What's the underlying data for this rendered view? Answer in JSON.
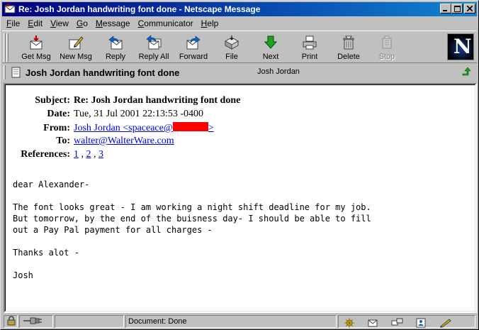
{
  "window": {
    "title": "Re: Josh Jordan handwriting font done - Netscape Message",
    "minimize": "_",
    "maximize": "□",
    "close": "✕"
  },
  "menu": [
    {
      "label": "File",
      "key": "F",
      "rest": "ile"
    },
    {
      "label": "Edit",
      "key": "E",
      "rest": "dit"
    },
    {
      "label": "View",
      "key": "V",
      "rest": "iew"
    },
    {
      "label": "Go",
      "key": "G",
      "rest": "o"
    },
    {
      "label": "Message",
      "key": "M",
      "rest": "essage"
    },
    {
      "label": "Communicator",
      "key": "C",
      "rest": "ommunicator"
    },
    {
      "label": "Help",
      "key": "H",
      "rest": "elp"
    }
  ],
  "toolbar": {
    "get_msg": "Get Msg",
    "new_msg": "New Msg",
    "reply": "Reply",
    "reply_all": "Reply All",
    "forward": "Forward",
    "file": "File",
    "next": "Next",
    "print": "Print",
    "delete": "Delete",
    "stop": "Stop",
    "logo_letter": "N"
  },
  "summary": {
    "title": "Josh Jordan handwriting font done",
    "from": "Josh Jordan"
  },
  "headers": {
    "subject_label": "Subject:",
    "subject": "Re: Josh Jordan handwriting font done",
    "date_label": "Date:",
    "date": "Tue, 31 Jul 2001 22:13:53 -0400",
    "from_label": "From:",
    "from_prefix": "Josh Jordan <spaceace@",
    "from_suffix": ">",
    "to_label": "To:",
    "to": "walter@WalterWare.com",
    "references_label": "References:",
    "ref1": "1",
    "ref2": "2",
    "ref3": "3",
    "ref_sep": " , "
  },
  "body": "dear Alexander-\n\nThe font looks great - I am working a night shift deadline for my job.\nBut tomorrow, by the end of the buisness day- I should be able to fill\nout a Pay Pal payment for all charges -\n\nThanks alot -\n\nJosh",
  "status": {
    "text": "Document: Done"
  },
  "colors": {
    "titlebar_start": "#000080",
    "titlebar_end": "#1084d0",
    "link": "#0000ee",
    "redaction": "#ff0000"
  }
}
